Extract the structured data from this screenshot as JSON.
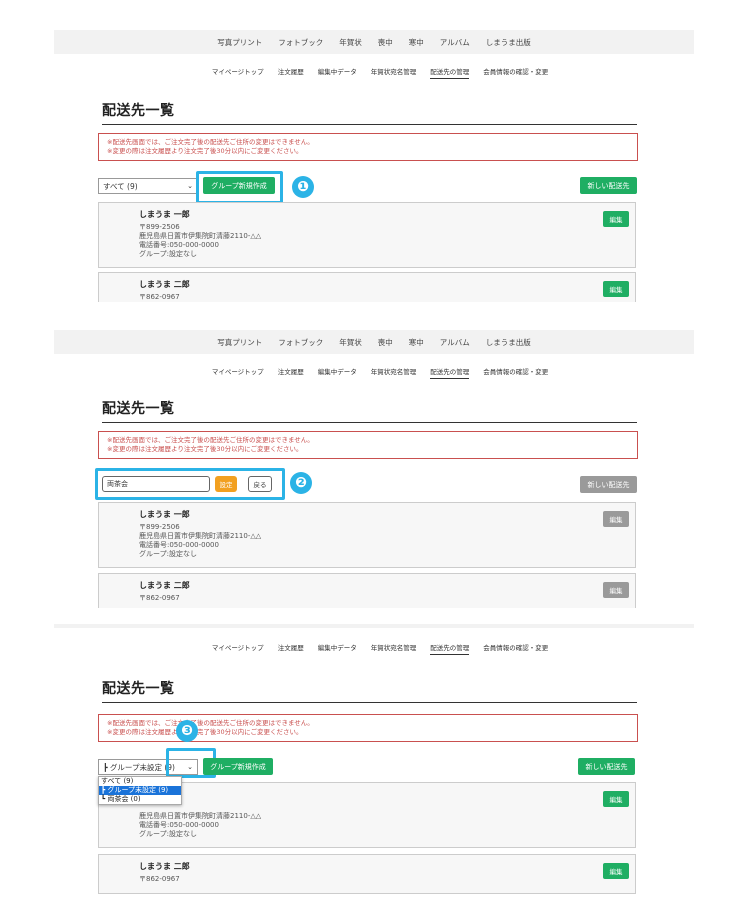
{
  "top_nav": [
    "写真プリント",
    "フォトブック",
    "年賀状",
    "喪中",
    "寒中",
    "アルバム",
    "しまうま出版"
  ],
  "sub_nav": [
    "マイページトップ",
    "注文履歴",
    "編集中データ",
    "年賀状宛名管理",
    "配送先の管理",
    "会員情報の確認・変更"
  ],
  "sub_nav_active": 4,
  "page_title": "配送先一覧",
  "notice": {
    "line1": "※配送先画面では、ご注文完了後の配送先ご住所の変更はできません。",
    "line2": "※変更の際は注文履歴より注文完了後30分以内にご変更ください。"
  },
  "panel1": {
    "group_select": "すべて (9)",
    "create_group_button": "グループ新規作成",
    "new_address_button": "新しい配送先",
    "badge": "❶"
  },
  "panel2": {
    "group_name_input": "両茶会",
    "set_button": "設定",
    "back_button": "戻る",
    "new_address_button": "新しい配送先",
    "badge": "❷"
  },
  "panel3": {
    "group_select": "┣ グループ未設定 (9)",
    "create_group_button": "グループ新規作成",
    "new_address_button": "新しい配送先",
    "badge": "❸",
    "dropdown_options": [
      "すべて (9)",
      "┣ グループ未設定 (9)",
      "┗ 両茶会 (0)"
    ],
    "dropdown_selected": 1,
    "card1_address": "鹿児島県日置市伊集院町清藤2110-△△"
  },
  "contacts": [
    {
      "name": "しまうま 一郎",
      "postal": "〒899-2506",
      "address": "鹿児島県日置市伊集院町清藤2110-△△",
      "phone": "電話番号:050-000-0000",
      "group": "グループ:設定なし"
    },
    {
      "name": "しまうま 二郎",
      "postal": "〒862-0967"
    }
  ],
  "edit_label": "編集",
  "colors": {
    "green": "#1fae63",
    "highlight": "#2bb3e6",
    "notice_red": "#c9504f",
    "orange": "#f2a020"
  }
}
